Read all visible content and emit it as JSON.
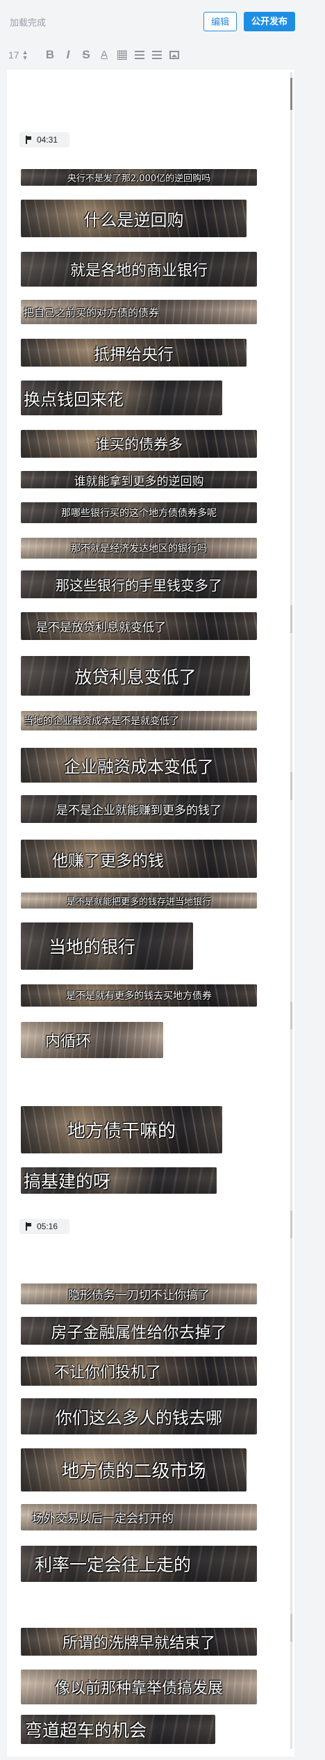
{
  "header": {
    "status": "加载完成",
    "edit_label": "编辑",
    "publish_label": "公开发布"
  },
  "toolbar": {
    "font_size": "17",
    "bold": "B",
    "italic": "I",
    "strikethrough": "S",
    "underline": "A",
    "icons": [
      "font-size-stepper-icon",
      "bold-icon",
      "italic-icon",
      "strikethrough-icon",
      "text-color-icon",
      "grid-icon",
      "ordered-list-icon",
      "bullet-list-icon",
      "image-icon"
    ]
  },
  "timestamps": [
    "04:31",
    "05:16"
  ],
  "subtitles_part1": [
    "央行不是发了那2,000亿的逆回购吗",
    "什么是逆回购",
    "就是各地的商业银行",
    "把自己之前买的对方债的债券",
    "抵押给央行",
    "换点钱回来花",
    "谁买的债券多",
    "谁就能拿到更多的逆回购",
    "那哪些银行买的这个地方债债券多呢",
    "那不就是经济发达地区的银行吗",
    "那这些银行的手里钱变多了",
    "是不是放贷利息就变低了",
    "放贷利息变低了",
    "当地的企业融资成本是不是就变低了",
    "企业融资成本变低了",
    "是不是企业就能赚到更多的钱了",
    "他赚了更多的钱",
    "是不是就能把更多的钱存进当地银行",
    "当地的银行",
    "是不是就有更多的钱去买地方债券",
    "内循环"
  ],
  "subtitles_mid": [
    "地方债干嘛的",
    "搞基建的呀"
  ],
  "subtitles_part2": [
    "隐形债务一刀切不让你搞了",
    "房子金融属性给你去掉了",
    "不让你们投机了",
    "你们这么多人的钱去哪",
    "地方债的二级市场",
    "场外交易以后一定会打开的",
    "利率一定会往上走的",
    "所谓的洗牌早就结束了",
    "像以前那种靠举债搞发展",
    "弯道超车的机会"
  ]
}
